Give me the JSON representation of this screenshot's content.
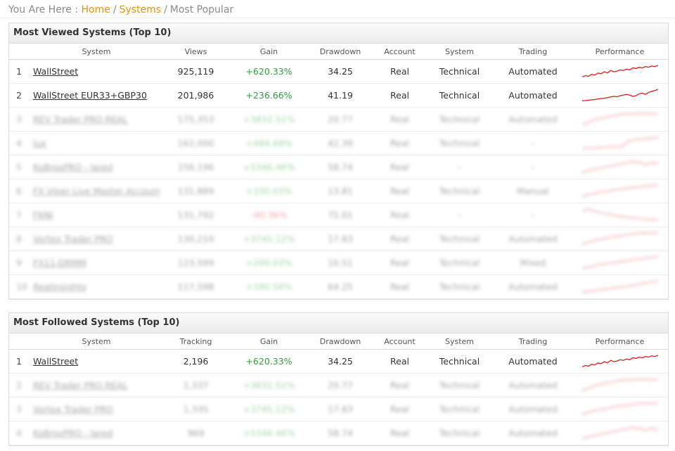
{
  "breadcrumb": {
    "prefix": "You Are Here :",
    "home": "Home",
    "systems": "Systems",
    "current": "Most Popular"
  },
  "colors": {
    "accent": "#e8910b",
    "gain_positive": "#2aa23a",
    "gain_negative": "#e03030",
    "sparkline": "#dd1c1c"
  },
  "viewed": {
    "title": "Most Viewed Systems (Top 10)",
    "headers": {
      "rank": "",
      "system": "System",
      "views": "Views",
      "gain": "Gain",
      "drawdown": "Drawdown",
      "account": "Account",
      "system_type": "System",
      "trading": "Trading",
      "performance": "Performance"
    },
    "rows": [
      {
        "rank": "1",
        "name": "WallStreet",
        "metric": "925,119",
        "gain": "+620.33%",
        "drawdown": "34.25",
        "account": "Real",
        "system": "Technical",
        "trading": "Automated",
        "blurred": false,
        "spark": [
          2,
          3,
          2.5,
          4,
          3.5,
          5,
          4.5,
          6,
          5,
          7,
          6,
          6.5,
          7.5,
          7,
          8,
          7.5,
          9,
          8.5,
          9.5,
          9,
          10,
          9.5,
          10.5,
          10,
          11
        ]
      },
      {
        "rank": "2",
        "name": "WallStreet EUR33+GBP30",
        "metric": "201,986",
        "gain": "+236.66%",
        "drawdown": "41.19",
        "account": "Real",
        "system": "Technical",
        "trading": "Automated",
        "blurred": false,
        "spark": [
          2,
          2.2,
          2.5,
          2.8,
          3,
          3.5,
          3.8,
          4,
          4.5,
          5,
          5.5,
          5.2,
          6,
          6.5,
          7,
          6.5,
          5.5,
          6,
          7.5,
          8,
          7,
          8.5,
          9.5,
          10,
          11
        ]
      },
      {
        "rank": "3",
        "name": "REV Trader PRO REAL",
        "metric": "175,353",
        "gain": "+3832.51%",
        "drawdown": "20.77",
        "account": "Real",
        "system": "Technical",
        "trading": "Automated",
        "blurred": true,
        "spark": [
          2,
          3,
          4,
          5,
          6,
          6.5,
          7,
          7.5,
          8,
          8.5,
          9,
          9.5,
          10,
          10.2,
          10.5,
          10.3,
          10.6,
          10.4,
          10.8,
          10.6,
          10.7,
          10.5,
          10.6,
          10.5,
          10.4
        ]
      },
      {
        "rank": "4",
        "name": "lux",
        "metric": "162,000",
        "gain": "+484.68%",
        "drawdown": "42.39",
        "account": "Real",
        "system": "Technical",
        "trading": "-",
        "blurred": true,
        "spark": [
          2,
          2.2,
          2.4,
          2.5,
          2.7,
          2.8,
          3,
          3.1,
          3.2,
          3.3,
          3.5,
          3.6,
          3.8,
          4,
          7,
          8,
          8.5,
          9,
          9.2,
          9.5,
          9.7,
          10,
          10.2,
          10.5,
          10.8
        ]
      },
      {
        "rank": "5",
        "name": "KoBrosPRO - Jared",
        "metric": "156,196",
        "gain": "+5346.46%",
        "drawdown": "58.74",
        "account": "Real",
        "system": "-",
        "trading": "-",
        "blurred": true,
        "spark": [
          2,
          3,
          3.5,
          4,
          4.5,
          5,
          5.5,
          6,
          6.5,
          7,
          7.5,
          8,
          8.5,
          9,
          9.5,
          10,
          11,
          9.5,
          10.5,
          9,
          8,
          9.5,
          10,
          8.5,
          10
        ]
      },
      {
        "rank": "6",
        "name": "FX Viper Live Master Account",
        "metric": "131,889",
        "gain": "+100.03%",
        "drawdown": "13.81",
        "account": "Real",
        "system": "Technical",
        "trading": "Manual",
        "blurred": true,
        "spark": [
          2,
          3,
          3.5,
          4,
          4.5,
          5,
          5.5,
          5.8,
          6.2,
          6.6,
          7,
          7.3,
          7.6,
          8,
          8.3,
          8.6,
          9,
          9.2,
          9.5,
          9.8,
          10,
          10.2,
          10.5,
          10.8,
          11
        ]
      },
      {
        "rank": "7",
        "name": "FKNI",
        "metric": "131,792",
        "gain": "-90.36%",
        "drawdown": "75.01",
        "account": "Real",
        "system": "-",
        "trading": "-",
        "blurred": true,
        "spark": [
          9,
          10,
          11,
          10,
          9,
          8.5,
          8,
          7.5,
          7,
          6.5,
          6,
          5.5,
          5,
          5,
          4.5,
          4.3,
          4,
          3.8,
          3.5,
          3.3,
          3,
          2.8,
          2.6,
          2.5,
          2.3
        ]
      },
      {
        "rank": "8",
        "name": "Vortex Trader PRO",
        "metric": "130,210",
        "gain": "+3745.12%",
        "drawdown": "17.83",
        "account": "Real",
        "system": "Technical",
        "trading": "Automated",
        "blurred": true,
        "spark": [
          2,
          3,
          4,
          4.5,
          5,
          5.5,
          6,
          6.5,
          7,
          7.5,
          8,
          8.3,
          8.6,
          9,
          9.3,
          9.6,
          10,
          10.3,
          10.6,
          10.8,
          11,
          10.8,
          10.6,
          10.9,
          11
        ]
      },
      {
        "rank": "9",
        "name": "FX11-DRMM",
        "metric": "123,599",
        "gain": "+200.03%",
        "drawdown": "16.51",
        "account": "Real",
        "system": "Technical",
        "trading": "Mixed",
        "blurred": true,
        "spark": [
          2,
          2.5,
          3,
          3.5,
          4,
          4.5,
          5,
          5.3,
          5.7,
          6,
          6.4,
          6.8,
          7.2,
          7.5,
          7.8,
          8.2,
          8.5,
          8.8,
          9.2,
          9.6,
          10,
          10.3,
          10.6,
          10.8,
          11
        ]
      },
      {
        "rank": "10",
        "name": "Realinsights",
        "metric": "117,598",
        "gain": "+180.56%",
        "drawdown": "64.25",
        "account": "Real",
        "system": "Technical",
        "trading": "Automated",
        "blurred": true,
        "spark": [
          2,
          2.3,
          2.6,
          3,
          3.3,
          3.6,
          4,
          4.3,
          4.6,
          5,
          5.3,
          5.6,
          6,
          6.3,
          6.6,
          7,
          7.4,
          7.8,
          8.2,
          8.6,
          9,
          9.5,
          10,
          10.5,
          11
        ]
      }
    ]
  },
  "followed": {
    "title": "Most Followed Systems (Top 10)",
    "headers": {
      "rank": "",
      "system": "System",
      "tracking": "Tracking",
      "gain": "Gain",
      "drawdown": "Drawdown",
      "account": "Account",
      "system_type": "System",
      "trading": "Trading",
      "performance": "Performance"
    },
    "rows": [
      {
        "rank": "1",
        "name": "WallStreet",
        "metric": "2,196",
        "gain": "+620.33%",
        "drawdown": "34.25",
        "account": "Real",
        "system": "Technical",
        "trading": "Automated",
        "blurred": false,
        "spark": [
          2,
          3,
          2.5,
          4,
          3.5,
          5,
          4.5,
          6,
          5,
          7,
          6,
          6.5,
          7.5,
          7,
          8,
          7.5,
          9,
          8.5,
          9.5,
          9,
          10,
          9.5,
          10.5,
          10,
          11
        ]
      },
      {
        "rank": "2",
        "name": "REV Trader PRO REAL",
        "metric": "1,337",
        "gain": "+3832.51%",
        "drawdown": "20.77",
        "account": "Real",
        "system": "Technical",
        "trading": "Automated",
        "blurred": true,
        "spark": [
          2,
          3,
          4,
          5,
          6,
          6.5,
          7,
          7.5,
          8,
          8.5,
          9,
          9.5,
          10,
          10.2,
          10.5,
          10.3,
          10.6,
          10.4,
          10.8,
          10.6,
          10.7,
          10.5,
          10.6,
          10.5,
          10.4
        ]
      },
      {
        "rank": "3",
        "name": "Vortex Trader PRO",
        "metric": "1,335",
        "gain": "+3745.12%",
        "drawdown": "17.83",
        "account": "Real",
        "system": "Technical",
        "trading": "Automated",
        "blurred": true,
        "spark": [
          2,
          3,
          4,
          4.5,
          5,
          5.5,
          6,
          6.5,
          7,
          7.5,
          8,
          8.3,
          8.6,
          9,
          9.3,
          9.6,
          10,
          10.3,
          10.6,
          10.8,
          11,
          10.8,
          10.6,
          10.9,
          11
        ]
      },
      {
        "rank": "4",
        "name": "KoBrosPRO - Jared",
        "metric": "969",
        "gain": "+5346.46%",
        "drawdown": "58.74",
        "account": "Real",
        "system": "Technical",
        "trading": "Automated",
        "blurred": true,
        "spark": [
          2,
          3,
          3.5,
          4,
          4.5,
          5,
          5.5,
          6,
          6.5,
          7,
          7.5,
          8,
          8.5,
          9,
          9.5,
          10,
          11,
          9.5,
          10.5,
          9,
          8,
          9.5,
          10,
          8.5,
          10
        ]
      }
    ]
  }
}
